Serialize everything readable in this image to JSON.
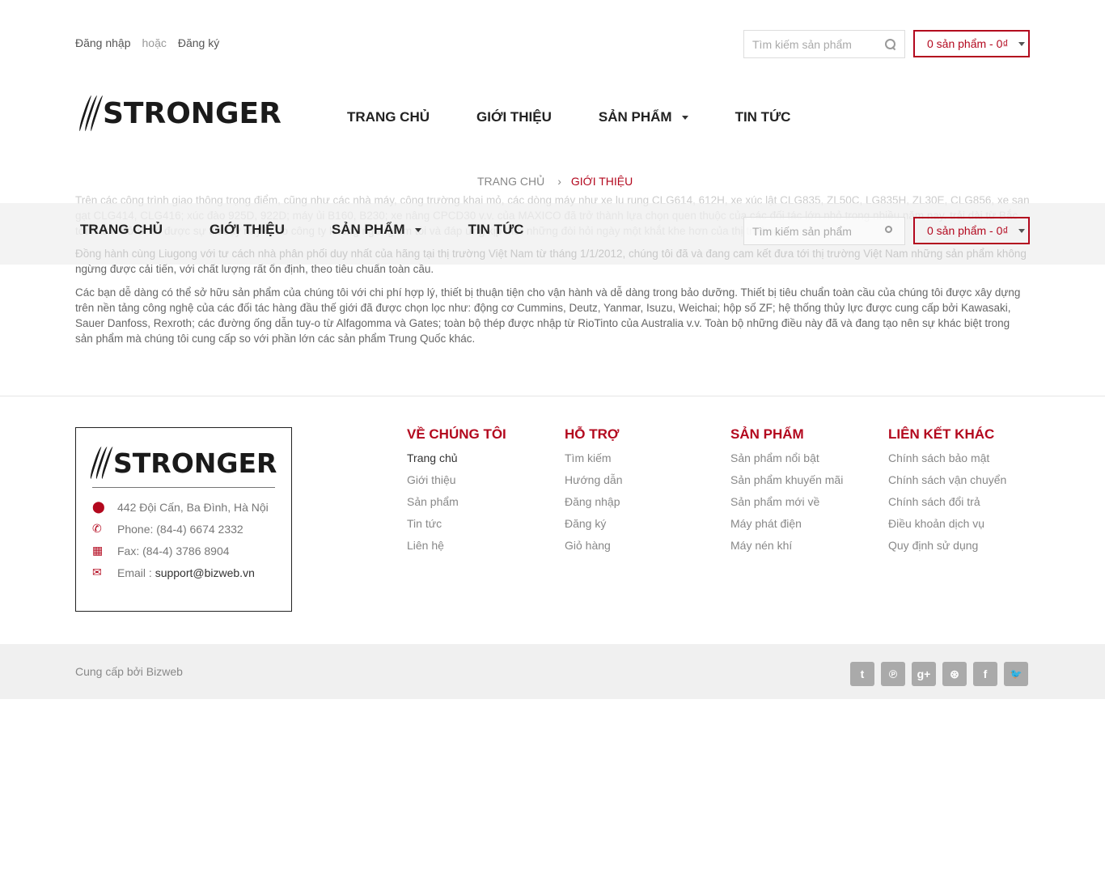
{
  "topbar": {
    "login": "Đăng nhập",
    "or": "hoặc",
    "register": "Đăng ký"
  },
  "search": {
    "placeholder": "Tìm kiếm sản phẩm"
  },
  "cart": {
    "label": "0 sản phẩm - 0₫"
  },
  "logo": {
    "text": "STRONGER"
  },
  "nav": {
    "home": "TRANG CHỦ",
    "about": "GIỚI THIỆU",
    "products": "SẢN PHẨM",
    "news": "TIN TỨC"
  },
  "breadcrumb": {
    "home": "TRANG CHỦ",
    "sep": "›",
    "current": "GIỚI THIỆU"
  },
  "content": {
    "para1": "Trên các công trình giao thông trọng điểm, cũng như các nhà máy, công trường khai mỏ, các dòng máy như xe lu rung CLG614, 612H, xe xúc lật CLG835, ZL50C, LG835H, ZL30E, CLG856, xe san gạt CLG414, CLG416; xúc đào 925D, 922D; máy ủi B160, B230; xe nâng CPCD30  v.v. của MAXICO đã trở thành lựa chọn quen thuộc của các đối tác lớn nhỏ trong nhiều năm nay. trải dài từ Bắc tới Nam. Sở dĩ có được sự tin cậy này là do công ty không ngừng tìm tòi và đáp ứng kịp thời những đòi hỏi ngày một khắt khe hơn của thị trường.",
    "para2": "Đồng hành cùng Liugong với tư cách nhà phân phối duy nhất của hãng tại thị trường Việt Nam từ tháng 1/1/2012, chúng tôi đã và đang cam kết đưa tới thị trường Việt Nam những sản phẩm không ngừng được cải tiến, với chất lượng rất ổn định, theo tiêu chuẩn toàn cầu.",
    "para3": "Các bạn dễ dàng có thể sở hữu sản phẩm của chúng tôi với chi phí hợp lý, thiết bị thuận tiện cho vận hành và dễ dàng trong bảo dưỡng. Thiết bị tiêu chuẩn toàn cầu của chúng tôi được xây dựng trên nền tảng công nghệ của các đối tác hàng đầu thế giới đã được chọn lọc như: động cơ Cummins, Deutz, Yanmar, Isuzu, Weichai; hộp số ZF; hệ thống thủy lực được cung cấp bởi Kawasaki, Sauer Danfoss, Rexroth; các đường ống dẫn tuy-o từ Alfagomma và Gates; toàn bộ thép được nhập từ RioTinto của Australia v.v. Toàn bộ những điều này đã và đang tạo nên sự khác biệt trong sản phẩm mà chúng tôi cung cấp so với phần lớn các sản phẩm Trung Quốc khác."
  },
  "footer": {
    "address": "442 Đội Cấn, Ba Đình, Hà Nội",
    "phone": "Phone: (84-4) 6674 2332",
    "fax": "Fax: (84-4) 3786 8904",
    "email_label": "Email : ",
    "email": "support@bizweb.vn",
    "cols": [
      {
        "title": "VỀ CHÚNG TÔI",
        "links": [
          "Trang chủ",
          "Giới thiệu",
          "Sản phẩm",
          "Tin tức",
          "Liên hệ"
        ]
      },
      {
        "title": "HỖ TRỢ",
        "links": [
          "Tìm kiếm",
          "Hướng dẫn",
          "Đăng nhập",
          "Đăng ký",
          "Giỏ hàng"
        ]
      },
      {
        "title": "SẢN PHẨM",
        "links": [
          "Sản phẩm nổi bật",
          "Sản phẩm khuyến mãi",
          "Sản phẩm mới về",
          "Máy phát điện",
          "Máy nén khí"
        ]
      },
      {
        "title": "LIÊN KẾT KHÁC",
        "links": [
          "Chính sách bảo mật",
          "Chính sách vận chuyển",
          "Chính sách đổi trả",
          "Điều khoản dịch vụ",
          "Quy định sử dụng"
        ]
      }
    ],
    "credit": "Cung cấp bởi Bizweb",
    "social": [
      {
        "name": "tumblr-icon",
        "glyph": "t"
      },
      {
        "name": "pinterest-icon",
        "glyph": "℗"
      },
      {
        "name": "google-plus-icon",
        "glyph": "g+"
      },
      {
        "name": "dribbble-icon",
        "glyph": "⊛"
      },
      {
        "name": "facebook-icon",
        "glyph": "f"
      },
      {
        "name": "twitter-icon",
        "glyph": "🐦"
      }
    ]
  },
  "colors": {
    "accent": "#b3081e"
  }
}
